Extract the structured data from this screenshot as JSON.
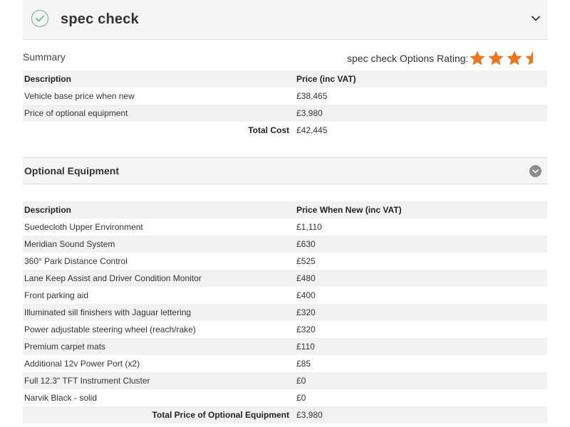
{
  "header": {
    "title": "spec check"
  },
  "summary": {
    "label": "Summary",
    "rating_label": "spec check Options Rating:",
    "rating": 3.5,
    "rating_max": 4,
    "star_color": "#e87722"
  },
  "summary_table": {
    "headers": [
      "Description",
      "Price (inc VAT)"
    ],
    "rows": [
      {
        "description": "Vehicle base price when new",
        "price": "£38,465"
      },
      {
        "description": "Price of optional equipment",
        "price": "£3,980"
      }
    ],
    "total_label": "Total Cost",
    "total_value": "£42,445"
  },
  "optional": {
    "title": "Optional Equipment",
    "headers": [
      "Description",
      "Price When New (inc VAT)"
    ],
    "rows": [
      {
        "description": "Suedecloth Upper Environment",
        "price": "£1,110"
      },
      {
        "description": "Meridian Sound System",
        "price": "£630"
      },
      {
        "description": "360° Park Distance Control",
        "price": "£525"
      },
      {
        "description": "Lane Keep Assist and Driver Condition Monitor",
        "price": "£480"
      },
      {
        "description": "Front parking aid",
        "price": "£400"
      },
      {
        "description": "Illuminated sill finishers with Jaguar lettering",
        "price": "£320"
      },
      {
        "description": "Power adjustable steering wheel (reach/rake)",
        "price": "£320"
      },
      {
        "description": "Premium carpet mats",
        "price": "£110"
      },
      {
        "description": "Additional 12v Power Port (x2)",
        "price": "£85"
      },
      {
        "description": "Full 12.3\" TFT Instrument Cluster",
        "price": "£0"
      },
      {
        "description": "Narvik Black - solid",
        "price": "£0"
      }
    ],
    "total_label": "Total Price of Optional Equipment",
    "total_value": "£3,980"
  },
  "colors": {
    "check_green": "#6ab28a",
    "header_bg": "#f5f5f5",
    "row_shade": "#f2f2f2",
    "chevron_grey": "#8c8c8c"
  }
}
